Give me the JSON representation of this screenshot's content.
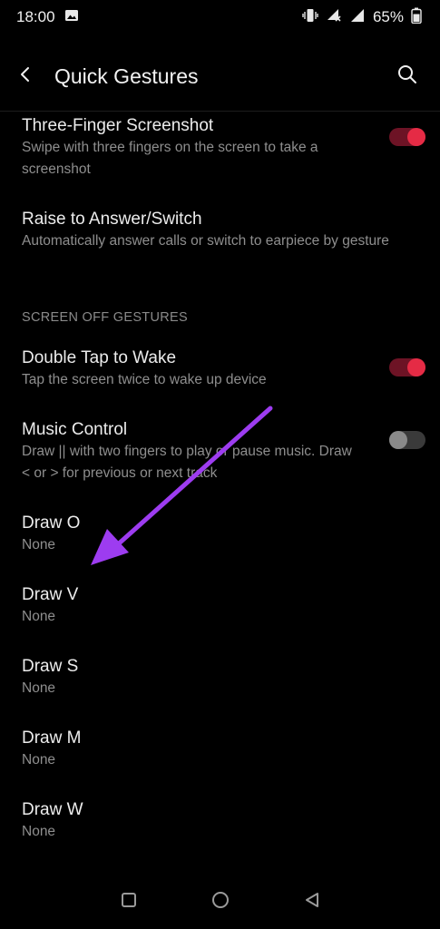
{
  "status_bar": {
    "time": "18:00",
    "battery": "65%"
  },
  "header": {
    "title": "Quick Gestures"
  },
  "items_top": [
    {
      "title": "Three-Finger Screenshot",
      "subtitle": "Swipe with three fingers on the screen to take a screenshot",
      "toggle": "on"
    },
    {
      "title": "Raise to Answer/Switch",
      "subtitle": "Automatically answer calls or switch to earpiece by gesture"
    }
  ],
  "section": {
    "label": "SCREEN OFF GESTURES"
  },
  "items_screen_off": [
    {
      "title": "Double Tap to Wake",
      "subtitle": "Tap the screen twice to wake up device",
      "toggle": "on"
    },
    {
      "title": "Music Control",
      "subtitle": "Draw || with two fingers to play or pause music. Draw < or > for previous or next track",
      "toggle": "off"
    },
    {
      "title": "Draw O",
      "subtitle": "None"
    },
    {
      "title": "Draw V",
      "subtitle": "None"
    },
    {
      "title": "Draw S",
      "subtitle": "None"
    },
    {
      "title": "Draw M",
      "subtitle": "None"
    },
    {
      "title": "Draw W",
      "subtitle": "None"
    }
  ],
  "colors": {
    "accent": "#e52b45",
    "annotation": "#9d3cf0"
  },
  "icons": [
    "image-icon",
    "vibrate-icon",
    "wifi-off-icon",
    "signal-icon",
    "battery-icon",
    "back-icon",
    "search-icon",
    "recents-icon",
    "home-icon",
    "nav-back-icon"
  ]
}
